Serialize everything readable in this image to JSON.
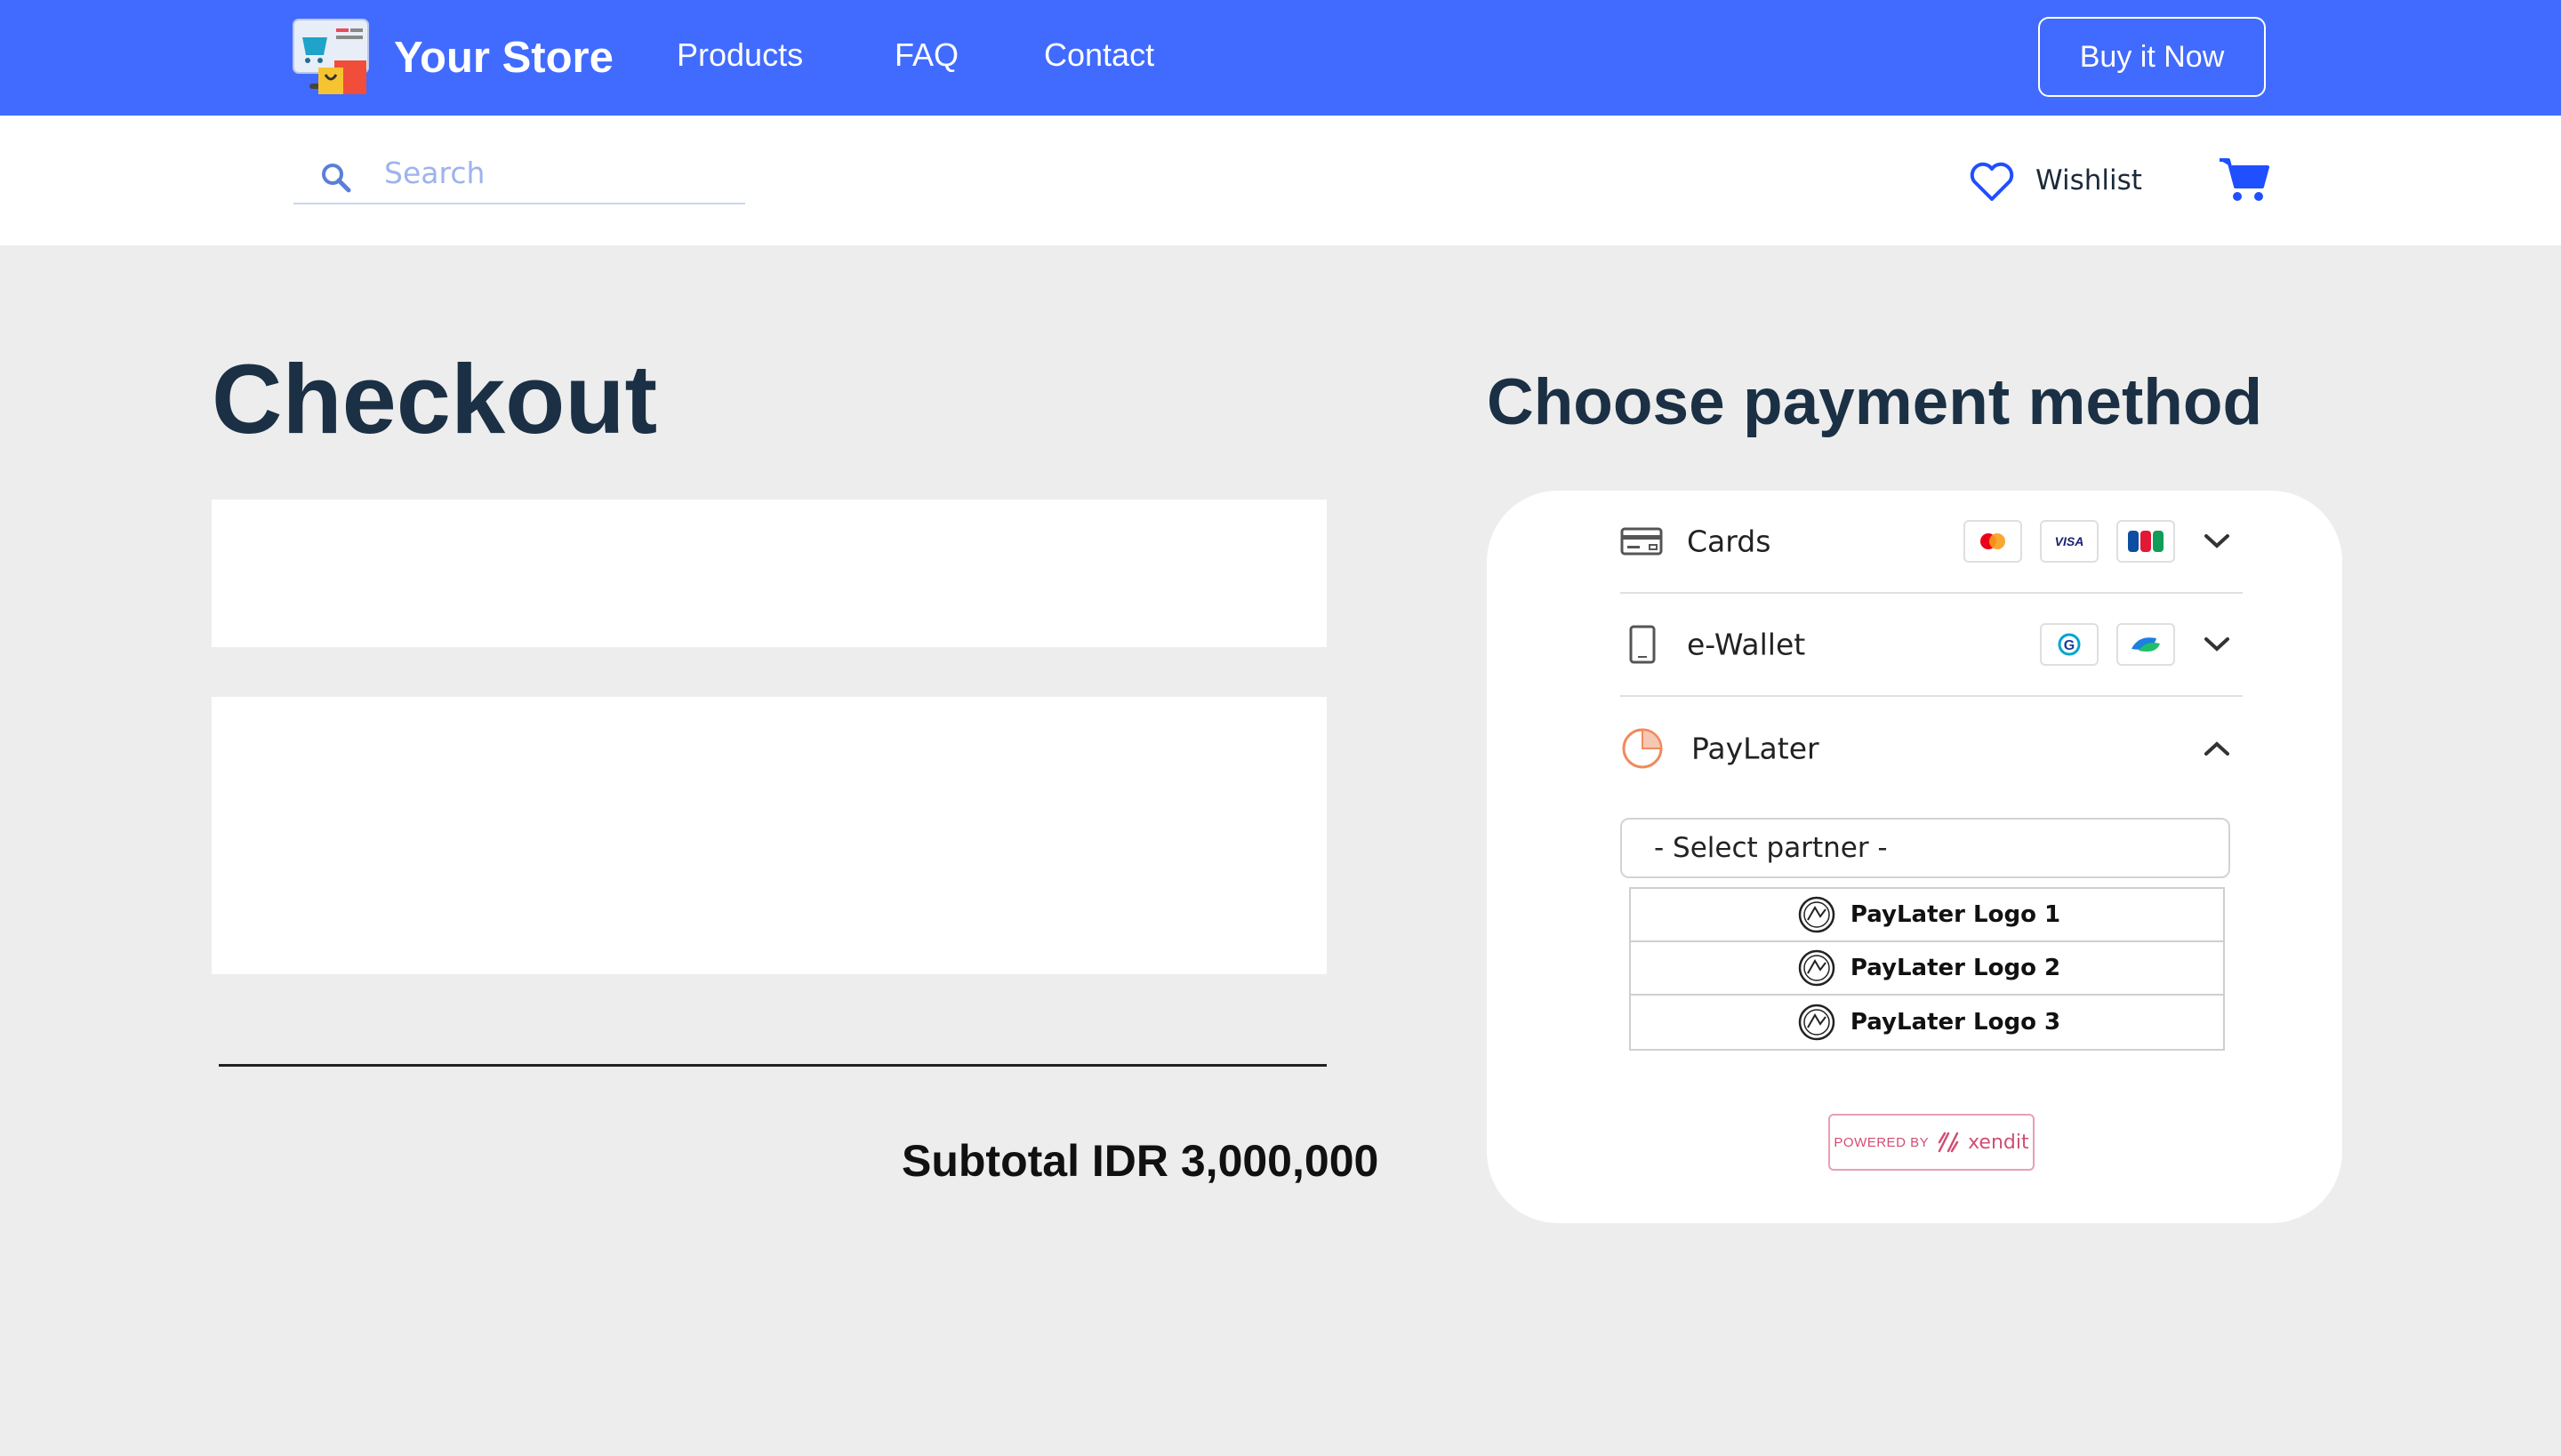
{
  "header": {
    "brand": "Your Store",
    "nav": [
      "Products",
      "FAQ",
      "Contact"
    ],
    "buy_label": "Buy it Now"
  },
  "search": {
    "placeholder": "Search"
  },
  "wishlist": {
    "label": "Wishlist"
  },
  "checkout": {
    "title": "Checkout",
    "subtotal": "Subtotal IDR 3,000,000"
  },
  "payment": {
    "title": "Choose payment method",
    "methods": [
      {
        "label": "Cards",
        "logos": [
          "mastercard-icon",
          "visa-icon",
          "jcb-icon"
        ],
        "expanded": false
      },
      {
        "label": "e-Wallet",
        "logos": [
          "wallet-g-icon",
          "wallet-leaf-icon"
        ],
        "expanded": false
      },
      {
        "label": "PayLater",
        "logos": [],
        "expanded": true
      }
    ],
    "select_placeholder": "- Select partner -",
    "partners": [
      "PayLater Logo 1",
      "PayLater Logo 2",
      "PayLater Logo 3"
    ],
    "powered_by": "POWERED BY",
    "provider": "xendit"
  },
  "colors": {
    "nav_bg": "#416bff",
    "page_bg": "#ededed",
    "heading": "#1b3044",
    "accent": "#1f4fff"
  }
}
